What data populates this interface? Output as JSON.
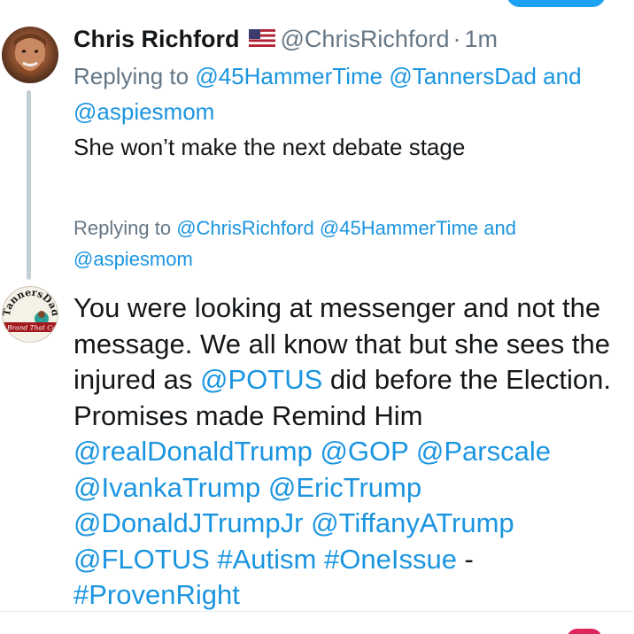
{
  "tweet1": {
    "author_name": "Chris Richford",
    "flag_icon": "us-flag-icon",
    "handle": "@ChrisRichford",
    "separator": "·",
    "time": "1m",
    "replying_to_prefix": "Replying to",
    "mentions": [
      "@45HammerTime",
      "@TannersDad"
    ],
    "and_word": "and",
    "mention_last": "@aspiesmom",
    "text": "She won’t make the next debate stage"
  },
  "tweet2": {
    "replying_to_prefix": "Replying to",
    "mentions": [
      "@ChrisRichford",
      "@45HammerTime"
    ],
    "and_word": "and",
    "mention_last": "@aspiesmom",
    "avatar_text_top": "TannersDad",
    "avatar_text_band": "Brand That Ca",
    "text_parts": {
      "p1": "You were looking at  messenger and not the message. We all know that but she sees the injured as ",
      "m1": "@POTUS",
      "p2": " did before the Election. Promises made Remind Him ",
      "m2": "@realDonaldTrump",
      "s1": " ",
      "m3": "@GOP",
      "s2": " ",
      "m4": "@Parscale",
      "s3": " ",
      "m5": "@IvankaTrump",
      "s4": " ",
      "m6": "@EricTrump",
      "s5": " ",
      "m7": "@DonaldJTrumpJr",
      "s6": " ",
      "m8": "@TiffanyATrump",
      "s7": " ",
      "m9": "@FLOTUS",
      "s8": " ",
      "h1": "#Autism",
      "s9": " ",
      "h2": "#OneIssue",
      "p3": " - ",
      "h3": "#ProvenRight"
    }
  },
  "colors": {
    "link": "#1b95e0",
    "muted": "#657786",
    "text": "#14171a",
    "thread_line": "#c4ced5",
    "accent": "#1da1f2"
  }
}
